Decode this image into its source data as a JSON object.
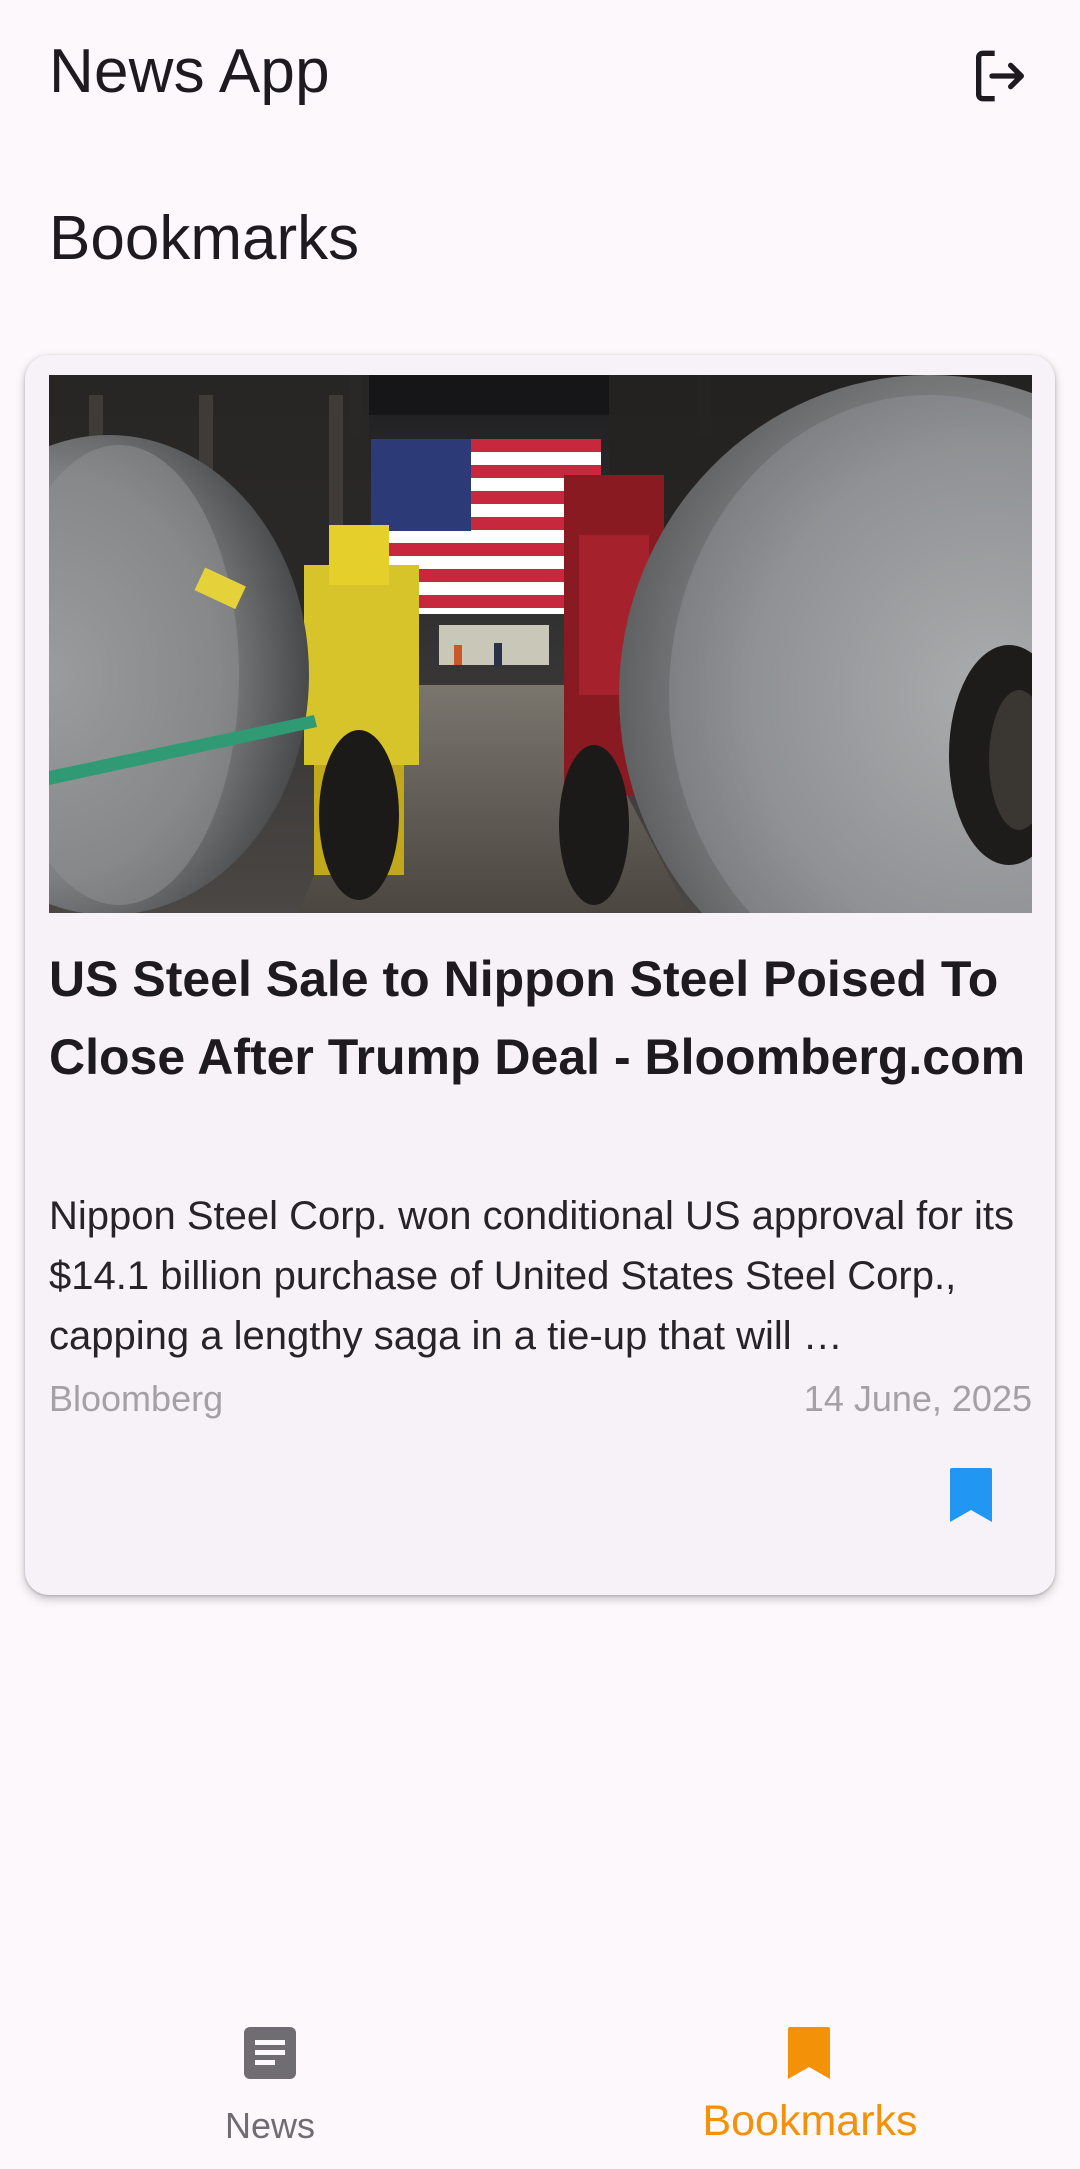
{
  "app_bar": {
    "title": "News App",
    "logout_icon": "logout-icon"
  },
  "section": {
    "title": "Bookmarks"
  },
  "article": {
    "image_icon": "steel-coils-photo",
    "title": "US Steel Sale to Nippon Steel Poised To Close After Trump Deal - Bloomberg.com",
    "description": "Nippon Steel Corp. won conditional US approval for its $14.1 billion purchase of United States Steel Corp., capping a lengthy saga in a tie-up that will …",
    "source": "Bloomberg",
    "date": "14 June, 2025",
    "bookmark_icon": "bookmark-filled-icon",
    "bookmark_color": "#2196f3"
  },
  "bottom_nav": {
    "items": [
      {
        "label": "News",
        "icon": "article-icon",
        "color": "#6f6c72",
        "selected": false
      },
      {
        "label": "Bookmarks",
        "icon": "bookmark-icon",
        "color": "#f39208",
        "selected": true
      }
    ]
  },
  "colors": {
    "background": "#fdf8fc",
    "card": "#f6f2f8",
    "accent": "#f39208",
    "bookmark_blue": "#2196f3",
    "muted_text": "#a3a0a6"
  }
}
